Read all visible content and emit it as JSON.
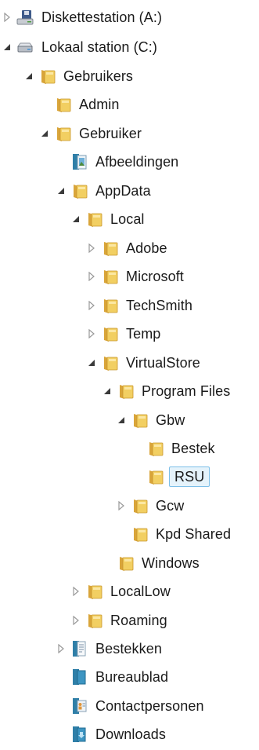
{
  "tree": {
    "items": [
      {
        "label": "Diskettestation (A:)",
        "icon": "floppy-drive-icon",
        "arrow": "collapsed"
      },
      {
        "label": "Lokaal station (C:)",
        "icon": "hard-drive-icon",
        "arrow": "expanded"
      },
      {
        "label": "Gebruikers",
        "icon": "folder-icon",
        "arrow": "expanded"
      },
      {
        "label": "Admin",
        "icon": "folder-icon",
        "arrow": "none"
      },
      {
        "label": "Gebruiker",
        "icon": "folder-icon",
        "arrow": "expanded"
      },
      {
        "label": "Afbeeldingen",
        "icon": "pictures-library-icon",
        "arrow": "none"
      },
      {
        "label": "AppData",
        "icon": "folder-icon",
        "arrow": "expanded"
      },
      {
        "label": "Local",
        "icon": "folder-icon",
        "arrow": "expanded"
      },
      {
        "label": "Adobe",
        "icon": "folder-icon",
        "arrow": "collapsed"
      },
      {
        "label": "Microsoft",
        "icon": "folder-icon",
        "arrow": "collapsed"
      },
      {
        "label": "TechSmith",
        "icon": "folder-icon",
        "arrow": "collapsed"
      },
      {
        "label": "Temp",
        "icon": "folder-icon",
        "arrow": "collapsed"
      },
      {
        "label": "VirtualStore",
        "icon": "folder-icon",
        "arrow": "expanded"
      },
      {
        "label": "Program Files",
        "icon": "folder-icon",
        "arrow": "expanded"
      },
      {
        "label": "Gbw",
        "icon": "folder-icon",
        "arrow": "expanded"
      },
      {
        "label": "Bestek",
        "icon": "folder-icon",
        "arrow": "none"
      },
      {
        "label": "RSU",
        "icon": "folder-icon",
        "arrow": "none",
        "selected": true
      },
      {
        "label": "Gcw",
        "icon": "folder-icon",
        "arrow": "collapsed"
      },
      {
        "label": "Kpd Shared",
        "icon": "folder-icon",
        "arrow": "none"
      },
      {
        "label": "Windows",
        "icon": "folder-icon",
        "arrow": "none"
      },
      {
        "label": "LocalLow",
        "icon": "folder-icon",
        "arrow": "collapsed"
      },
      {
        "label": "Roaming",
        "icon": "folder-icon",
        "arrow": "collapsed"
      },
      {
        "label": "Bestekken",
        "icon": "documents-library-icon",
        "arrow": "collapsed"
      },
      {
        "label": "Bureaublad",
        "icon": "desktop-library-icon",
        "arrow": "none"
      },
      {
        "label": "Contactpersonen",
        "icon": "contacts-library-icon",
        "arrow": "none"
      },
      {
        "label": "Downloads",
        "icon": "downloads-library-icon",
        "arrow": "none"
      }
    ]
  }
}
